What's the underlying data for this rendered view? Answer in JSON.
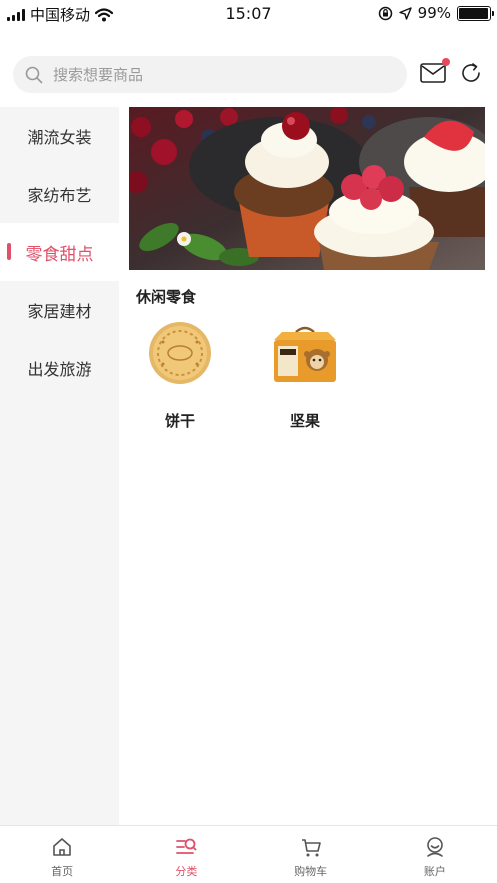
{
  "status_bar": {
    "carrier": "中国移动",
    "time": "15:07",
    "battery": "99%"
  },
  "search": {
    "placeholder": "搜索想要商品"
  },
  "sidebar": {
    "items": [
      {
        "label": "潮流女装",
        "active": false
      },
      {
        "label": "家纺布艺",
        "active": false
      },
      {
        "label": "零食甜点",
        "active": true
      },
      {
        "label": "家居建材",
        "active": false
      },
      {
        "label": "出发旅游",
        "active": false
      }
    ]
  },
  "main": {
    "section_title": "休闲零食",
    "products": [
      {
        "name": "饼干",
        "icon": "biscuit-icon"
      },
      {
        "name": "坚果",
        "icon": "nut-box-icon"
      }
    ]
  },
  "tabbar": {
    "items": [
      {
        "label": "首页",
        "icon": "home-icon",
        "active": false
      },
      {
        "label": "分类",
        "icon": "category-icon",
        "active": true
      },
      {
        "label": "购物车",
        "icon": "cart-icon",
        "active": false
      },
      {
        "label": "账户",
        "icon": "account-icon",
        "active": false
      }
    ]
  },
  "colors": {
    "accent": "#e0506a",
    "sidebar_bg": "#f5f5f5",
    "notification_dot": "#e64a5a"
  }
}
